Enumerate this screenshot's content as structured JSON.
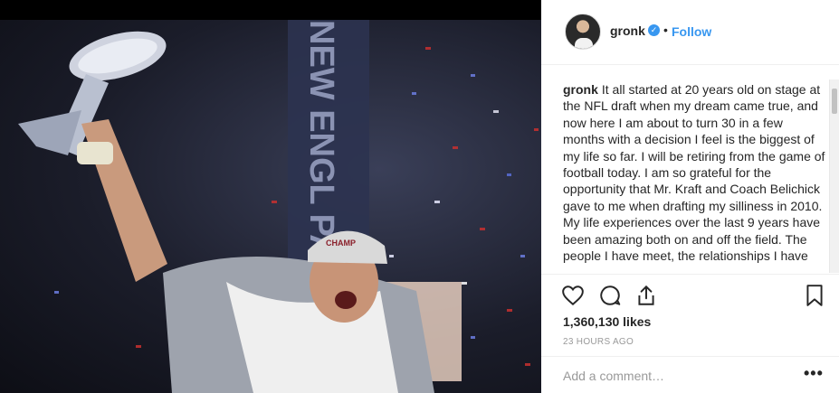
{
  "post": {
    "username": "gronk",
    "verified_icon": "verified-badge-icon",
    "separator": "•",
    "follow_label": "Follow",
    "caption_user": "gronk",
    "caption_text": "It all started at 20 years old on stage at the NFL draft when my dream came true, and now here I am about to turn 30 in a few months with a decision I feel is the biggest of my life so far. I will be retiring from the game of football today. I am so grateful for the opportunity that Mr. Kraft and Coach Belichick gave to me when drafting my silliness in 2010. My life experiences over the last 9 years have been amazing both on and off the field. The people I have meet, the relationships I have",
    "likes": "1,360,130 likes",
    "timestamp": "23 HOURS AGO",
    "comment_placeholder": "Add a comment…",
    "more_label": "•••"
  },
  "photo": {
    "banner_text": "NEW ENGL PATRIOTS",
    "cap_text": "CHAMP"
  },
  "icons": {
    "like": "heart-icon",
    "comment": "comment-icon",
    "share": "share-icon",
    "save": "bookmark-icon"
  },
  "colors": {
    "link": "#3897f0",
    "text": "#262626",
    "muted": "#999999"
  }
}
